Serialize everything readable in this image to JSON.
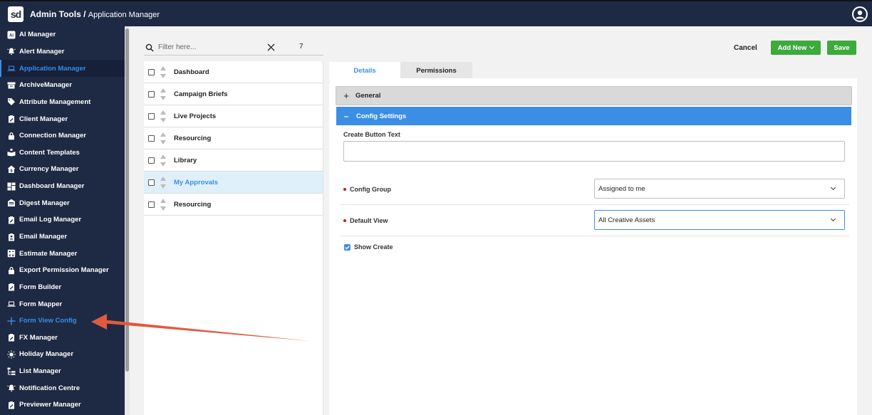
{
  "header": {
    "logo_text": "sd",
    "title_main": "Admin Tools /",
    "title_sub": "Application Manager"
  },
  "sidebar": {
    "items": [
      {
        "label": "AI Manager",
        "icon": "ai-icon"
      },
      {
        "label": "Alert Manager",
        "icon": "bell-icon"
      },
      {
        "label": "Application Manager",
        "icon": "laptop-icon",
        "active": true
      },
      {
        "label": "ArchiveManager",
        "icon": "archive-icon"
      },
      {
        "label": "Attribute Management",
        "icon": "tag-icon"
      },
      {
        "label": "Client Manager",
        "icon": "clipboard-edit-icon"
      },
      {
        "label": "Connection Manager",
        "icon": "lock-icon"
      },
      {
        "label": "Content Templates",
        "icon": "content-template-icon"
      },
      {
        "label": "Currency Manager",
        "icon": "currency-icon"
      },
      {
        "label": "Dashboard Manager",
        "icon": "dashboard-icon"
      },
      {
        "label": "Digest Manager",
        "icon": "digest-icon"
      },
      {
        "label": "Email Log Manager",
        "icon": "clipboard-edit-icon"
      },
      {
        "label": "Email Manager",
        "icon": "clipboard-user-icon"
      },
      {
        "label": "Estimate Manager",
        "icon": "calculator-icon"
      },
      {
        "label": "Export Permission Manager",
        "icon": "lock-icon"
      },
      {
        "label": "Form Builder",
        "icon": "clipboard-edit-icon"
      },
      {
        "label": "Form Mapper",
        "icon": "laptop-icon"
      },
      {
        "label": "Form View Config",
        "icon": "plus-icon",
        "highlight": true
      },
      {
        "label": "FX Manager",
        "icon": "clipboard-edit-icon"
      },
      {
        "label": "Holiday Manager",
        "icon": "sun-icon"
      },
      {
        "label": "List Manager",
        "icon": "list-tree-icon"
      },
      {
        "label": "Notification Centre",
        "icon": "bell-icon"
      },
      {
        "label": "Previewer Manager",
        "icon": "clipboard-edit-icon"
      }
    ]
  },
  "filter": {
    "placeholder": "Filter here...",
    "count": "7"
  },
  "list": {
    "items": [
      {
        "label": "Dashboard"
      },
      {
        "label": "Campaign Briefs"
      },
      {
        "label": "Live Projects"
      },
      {
        "label": "Resourcing"
      },
      {
        "label": "Library"
      },
      {
        "label": "My Approvals",
        "selected": true
      },
      {
        "label": "Resourcing"
      }
    ]
  },
  "toolbar": {
    "cancel_label": "Cancel",
    "add_new_label": "Add New",
    "save_label": "Save"
  },
  "tabs": {
    "details": "Details",
    "permissions": "Permissions"
  },
  "sections": {
    "general": "General",
    "config_settings": "Config Settings"
  },
  "form": {
    "create_button_text_label": "Create Button Text",
    "create_button_text_value": "",
    "config_group_label": "Config Group",
    "config_group_value": "Assigned to me",
    "default_view_label": "Default View",
    "default_view_value": "All Creative Assets",
    "show_create_label": "Show Create",
    "show_create_checked": true
  },
  "colors": {
    "header_bg": "#1e2a44",
    "accent": "#3a8ee6",
    "button_green": "#3caa3c",
    "annotation_arrow": "#e05a40",
    "required": "#cc1a1a"
  }
}
